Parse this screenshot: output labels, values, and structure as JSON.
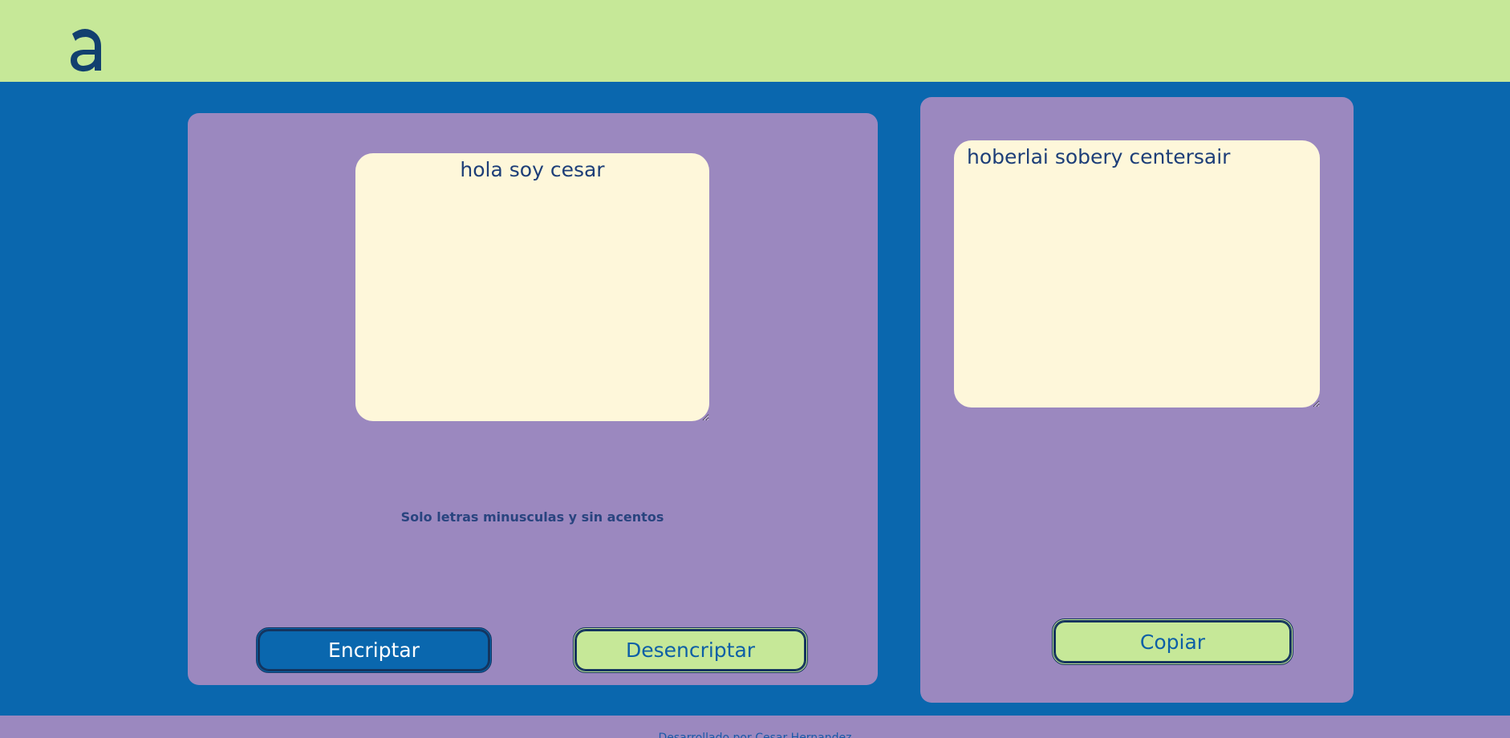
{
  "header": {
    "logo_glyph": "a",
    "logo_color": "#12406f",
    "background": "#c6e898"
  },
  "encrypt_panel": {
    "input_value": "hola soy cesar",
    "hint": "Solo letras minusculas y sin acentos",
    "encrypt_button_label": "Encriptar",
    "decrypt_button_label": "Desencriptar"
  },
  "result_panel": {
    "output_value": "hoberlai sobery centersair",
    "copy_button_label": "Copiar"
  },
  "footer": {
    "text": "Desarrollado por Cesar Hernandez"
  },
  "colors": {
    "main_background": "#0a67ae",
    "panel": "#9b88bf",
    "textarea": "#fef7da",
    "accent_green": "#c6e898",
    "text_dark": "#1d3e78"
  }
}
